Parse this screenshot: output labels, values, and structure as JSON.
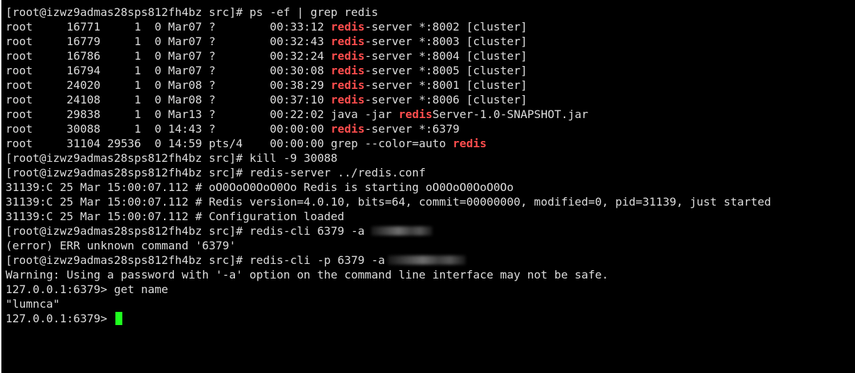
{
  "terminal": {
    "prompt": "[root@izwz9admas28sps812fh4bz src]#",
    "cmd_ps": "ps -ef | grep redis",
    "highlight": "redis",
    "processes": [
      {
        "user": "root",
        "pid": "16771",
        "ppid": "1",
        "c": "0",
        "stime": "Mar07",
        "tty": "?",
        "time": "00:33:12",
        "cmd_rest": "-server *:8002 [cluster]"
      },
      {
        "user": "root",
        "pid": "16779",
        "ppid": "1",
        "c": "0",
        "stime": "Mar07",
        "tty": "?",
        "time": "00:32:43",
        "cmd_rest": "-server *:8003 [cluster]"
      },
      {
        "user": "root",
        "pid": "16786",
        "ppid": "1",
        "c": "0",
        "stime": "Mar07",
        "tty": "?",
        "time": "00:32:24",
        "cmd_rest": "-server *:8004 [cluster]"
      },
      {
        "user": "root",
        "pid": "16794",
        "ppid": "1",
        "c": "0",
        "stime": "Mar07",
        "tty": "?",
        "time": "00:30:08",
        "cmd_rest": "-server *:8005 [cluster]"
      },
      {
        "user": "root",
        "pid": "24020",
        "ppid": "1",
        "c": "0",
        "stime": "Mar08",
        "tty": "?",
        "time": "00:38:29",
        "cmd_rest": "-server *:8001 [cluster]"
      },
      {
        "user": "root",
        "pid": "24108",
        "ppid": "1",
        "c": "0",
        "stime": "Mar08",
        "tty": "?",
        "time": "00:37:10",
        "cmd_rest": "-server *:8006 [cluster]"
      },
      {
        "user": "root",
        "pid": "29838",
        "ppid": "1",
        "c": "0",
        "stime": "Mar13",
        "tty": "?",
        "time": "00:22:02",
        "cmd_pre": "java -jar ",
        "cmd_rest": "Server-1.0-SNAPSHOT.jar"
      },
      {
        "user": "root",
        "pid": "30088",
        "ppid": "1",
        "c": "0",
        "stime": "14:43",
        "tty": "?",
        "time": "00:00:00",
        "cmd_rest": "-server *:6379"
      },
      {
        "user": "root",
        "pid": "31104",
        "ppid": "29536",
        "c": "0",
        "stime": "14:59",
        "tty": "pts/4",
        "time": "00:00:00",
        "cmd_pre": "grep --color=auto ",
        "cmd_rest": ""
      }
    ],
    "cmd_kill": "kill -9 30088",
    "cmd_server": "redis-server ../redis.conf",
    "log_lines": [
      "31139:C 25 Mar 15:00:07.112 # oO0OoO0OoO0Oo Redis is starting oO0OoO0OoO0Oo",
      "31139:C 25 Mar 15:00:07.112 # Redis version=4.0.10, bits=64, commit=00000000, modified=0, pid=31139, just started",
      "31139:C 25 Mar 15:00:07.112 # Configuration loaded"
    ],
    "cmd_cli_1": "redis-cli 6379 -a",
    "error_line": "(error) ERR unknown command '6379'",
    "cmd_cli_2": "redis-cli -p 6379 -a",
    "warning_line": "Warning: Using a password with '-a' option on the command line interface may not be safe.",
    "cli_prompt": "127.0.0.1:6379>",
    "cmd_get": "get name",
    "get_result": "\"lumnca\""
  }
}
